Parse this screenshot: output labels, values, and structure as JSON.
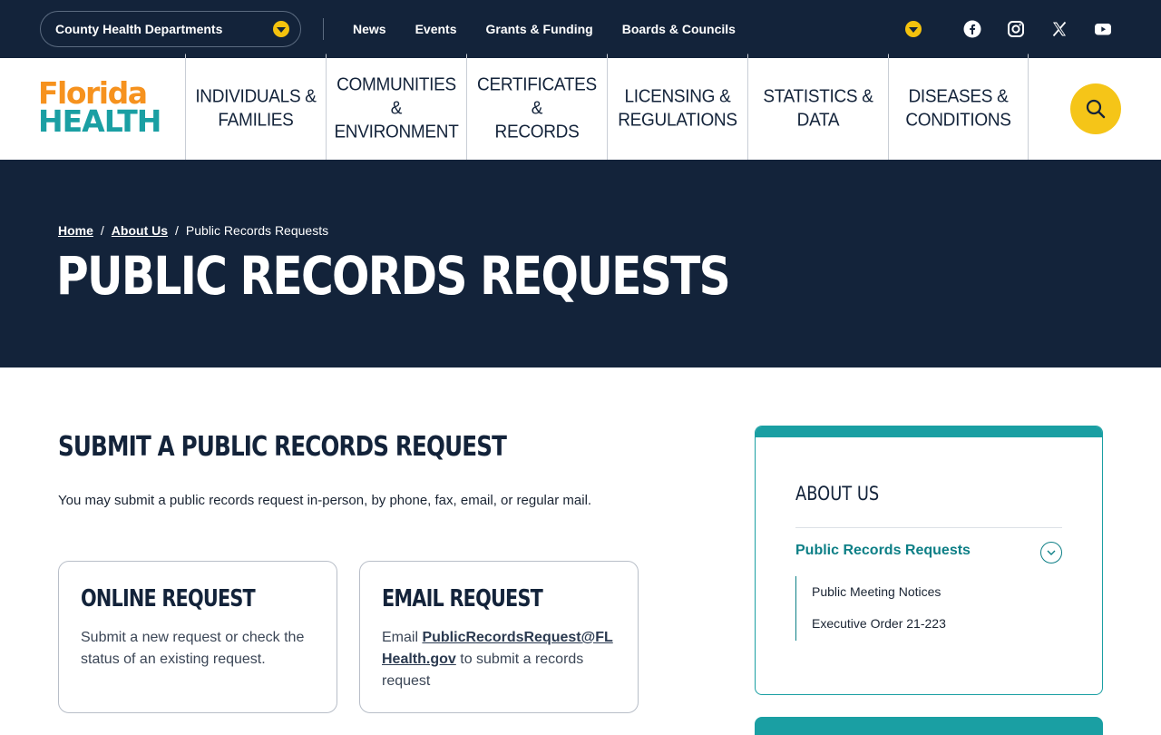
{
  "topbar": {
    "county_dropdown": "County Health Departments",
    "links": [
      "News",
      "Events",
      "Grants & Funding",
      "Boards & Councils"
    ],
    "social": [
      "facebook-icon",
      "instagram-icon",
      "x-icon",
      "youtube-icon"
    ]
  },
  "logo": {
    "line1": "Florida",
    "line2": "HEALTH"
  },
  "nav": [
    [
      "INDIVIDUALS &",
      "FAMILIES"
    ],
    [
      "COMMUNITIES",
      "&",
      "ENVIRONMENT"
    ],
    [
      "CERTIFICATES",
      "&",
      "RECORDS"
    ],
    [
      "LICENSING &",
      "REGULATIONS"
    ],
    [
      "STATISTICS &",
      "DATA"
    ],
    [
      "DISEASES &",
      "CONDITIONS"
    ]
  ],
  "breadcrumb": {
    "home": "Home",
    "about": "About Us",
    "current": "Public Records Requests",
    "sep": "/"
  },
  "hero_title": "PUBLIC RECORDS REQUESTS",
  "main": {
    "heading": "SUBMIT A PUBLIC RECORDS REQUEST",
    "intro": "You may submit a public records request in-person, by phone, fax, email, or regular mail.",
    "cards": {
      "online": {
        "title": "ONLINE REQUEST",
        "text": "Submit a new request or check the status of an existing request."
      },
      "email": {
        "title": "EMAIL REQUEST",
        "prefix": "Email ",
        "link": "PublicRecordsRequest@FLHealth.gov",
        "suffix": " to submit a records request"
      }
    }
  },
  "sidebar": {
    "title": "ABOUT US",
    "active": "Public Records Requests",
    "items": [
      "Public Meeting Notices",
      "Executive Order 21-223"
    ]
  },
  "colors": {
    "navy": "#13233a",
    "teal": "#1a9fa3",
    "yellow": "#f5c518",
    "orange": "#f6921e"
  }
}
